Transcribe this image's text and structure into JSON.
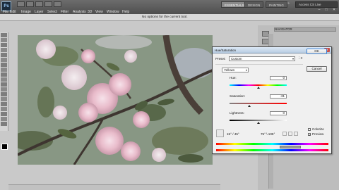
{
  "app": {
    "logo_text": "Ps",
    "menu": [
      "File",
      "Edit",
      "Image",
      "Layer",
      "Select",
      "Filter",
      "Analysis",
      "3D",
      "View",
      "Window",
      "Help"
    ],
    "workspaces": [
      "ESSENTIALS",
      "DESIGN",
      "PAINTING"
    ],
    "workspace_more": "»",
    "cs_live": "Access CS Live",
    "window_controls": [
      "–",
      "□",
      "✕"
    ]
  },
  "options_bar": {
    "text": "No options for the current tool."
  },
  "panels": {
    "tab_label": "NAVIGATOR"
  },
  "dialog": {
    "title": "Hue/Saturation",
    "close": "✕",
    "preset_label": "Preset:",
    "preset_value": "Custom",
    "channel_value": "Yellows",
    "hue_label": "Hue:",
    "hue_value": "0",
    "saturation_label": "Saturation:",
    "saturation_value": "-31",
    "lightness_label": "Lightness:",
    "lightness_value": "0",
    "range_left": "15° / 45°",
    "range_right": "75° \\ 105°",
    "colorize_label": "Colorize",
    "colorize_checked": false,
    "preview_label": "Preview",
    "preview_checked": true,
    "ok_label": "OK",
    "cancel_label": "Cancel",
    "sliders": {
      "hue": {
        "min": -180,
        "max": 180,
        "value": 0
      },
      "saturation": {
        "min": -100,
        "max": 100,
        "value": -31
      },
      "lightness": {
        "min": -100,
        "max": 100,
        "value": 0
      }
    }
  },
  "colors": {
    "menubar": "#555555",
    "dialog_bg": "#f0f0f0",
    "accent": "#3b7fd0"
  }
}
